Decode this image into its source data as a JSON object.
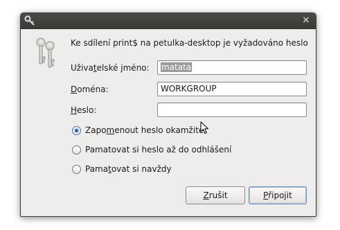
{
  "dialog": {
    "title_icon": "key-icon",
    "close_glyph": "×",
    "side_icon": "keys-icon",
    "prompt": "Ke sdílení print$ na petulka-desktop je vyžadováno heslo"
  },
  "fields": {
    "username": {
      "label_pre": "Uživa",
      "label_u": "t",
      "label_post": "elské jméno:",
      "value": "matata"
    },
    "domain": {
      "label_pre": "",
      "label_u": "D",
      "label_post": "oména:",
      "value": "WORKGROUP"
    },
    "password": {
      "label_pre": "",
      "label_u": "H",
      "label_post": "eslo:",
      "value": ""
    }
  },
  "radios": [
    {
      "pre": "Zapo",
      "u": "m",
      "post": "enout heslo okamžitě",
      "checked": true
    },
    {
      "pre": "Pamatovat si heslo až do odhlášení",
      "u": "",
      "post": "",
      "checked": false
    },
    {
      "pre": "Pama",
      "u": "t",
      "post": "ovat si navždy",
      "checked": false
    }
  ],
  "buttons": {
    "cancel": {
      "u": "Z",
      "post": "rušit"
    },
    "connect": {
      "u": "P",
      "post": "řipojit"
    }
  },
  "colors": {
    "titlebar": "#3a3a37",
    "dialog_bg": "#efedeb",
    "selection": "#9a9a9a",
    "radio_accent": "#3d6aa6"
  }
}
